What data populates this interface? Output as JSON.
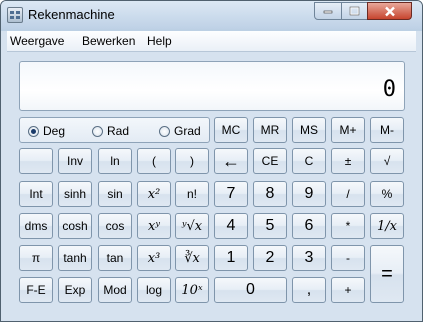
{
  "window": {
    "title": "Rekenmachine"
  },
  "menu": [
    "Weergave",
    "Bewerken",
    "Help"
  ],
  "display": {
    "value": "0"
  },
  "angle_modes": [
    {
      "label": "Deg",
      "selected": true
    },
    {
      "label": "Rad",
      "selected": false
    },
    {
      "label": "Grad",
      "selected": false
    }
  ],
  "memory_buttons": [
    "MC",
    "MR",
    "MS",
    "M+",
    "M-"
  ],
  "rows": [
    [
      "",
      "Inv",
      "ln",
      "(",
      ")",
      "←",
      "CE",
      "C",
      "±",
      "√"
    ],
    [
      "Int",
      "sinh",
      "sin",
      "x²",
      "n!",
      "7",
      "8",
      "9",
      "/",
      "%"
    ],
    [
      "dms",
      "cosh",
      "cos",
      "xʸ",
      "ʸ√x",
      "4",
      "5",
      "6",
      "*",
      "1/x"
    ],
    [
      "π",
      "tanh",
      "tan",
      "x³",
      "∛x",
      "1",
      "2",
      "3",
      "-",
      "="
    ],
    [
      "F-E",
      "Exp",
      "Mod",
      "log",
      "10ˣ",
      "0",
      ",",
      "+"
    ]
  ]
}
